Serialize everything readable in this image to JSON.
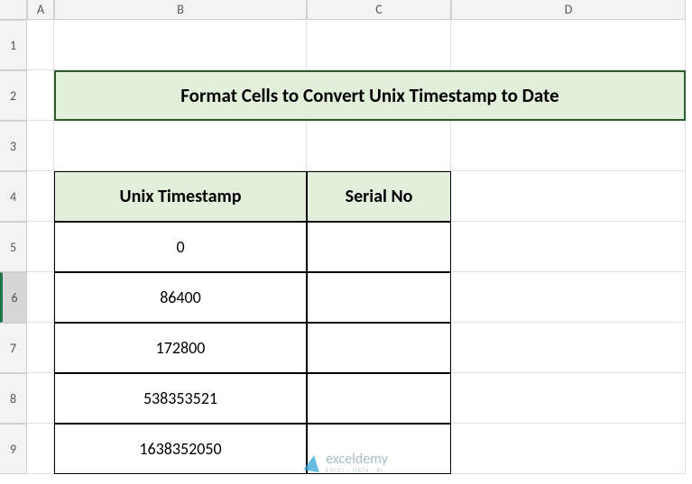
{
  "columns": [
    "A",
    "B",
    "C",
    "D"
  ],
  "rows": [
    "1",
    "2",
    "3",
    "4",
    "5",
    "6",
    "7",
    "8",
    "9"
  ],
  "selected_row": 6,
  "title": "Format Cells to Convert Unix Timestamp to Date",
  "table": {
    "headers": [
      "Unix Timestamp",
      "Serial No"
    ],
    "data": [
      {
        "timestamp": "0",
        "serial": ""
      },
      {
        "timestamp": "86400",
        "serial": ""
      },
      {
        "timestamp": "172800",
        "serial": ""
      },
      {
        "timestamp": "538353521",
        "serial": ""
      },
      {
        "timestamp": "1638352050",
        "serial": ""
      }
    ]
  },
  "watermark": {
    "main": "exceldemy",
    "sub": "EXCEL · DATA · BI"
  }
}
